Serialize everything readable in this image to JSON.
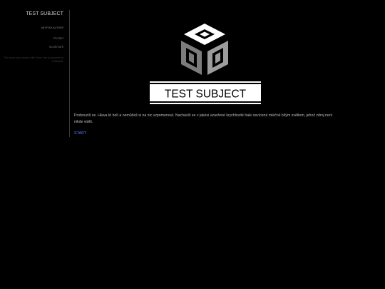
{
  "sidebar": {
    "story_title": "TEST SUBJECT",
    "story_author": "anyfoolauthor",
    "menu": [
      {
        "label": "Restart"
      },
      {
        "label": "Bookmark"
      }
    ],
    "note": "This story was created with Twine and is powered by TiddlyWiki"
  },
  "logo": {
    "title": "TEST SUBJECT"
  },
  "passage": {
    "text": "Probouzíš se. Hlava tě bolí a nemůžeš si na nic vzpomenout. Nacházíš se v jakési uzavřené krychlovité hale osvícené mléčně bílým světlem, jehož zdroj není nikde vidět.",
    "choice_label": "START"
  },
  "colors": {
    "background": "#000000",
    "link": "#5b7fff",
    "text": "#bdbdbd"
  }
}
